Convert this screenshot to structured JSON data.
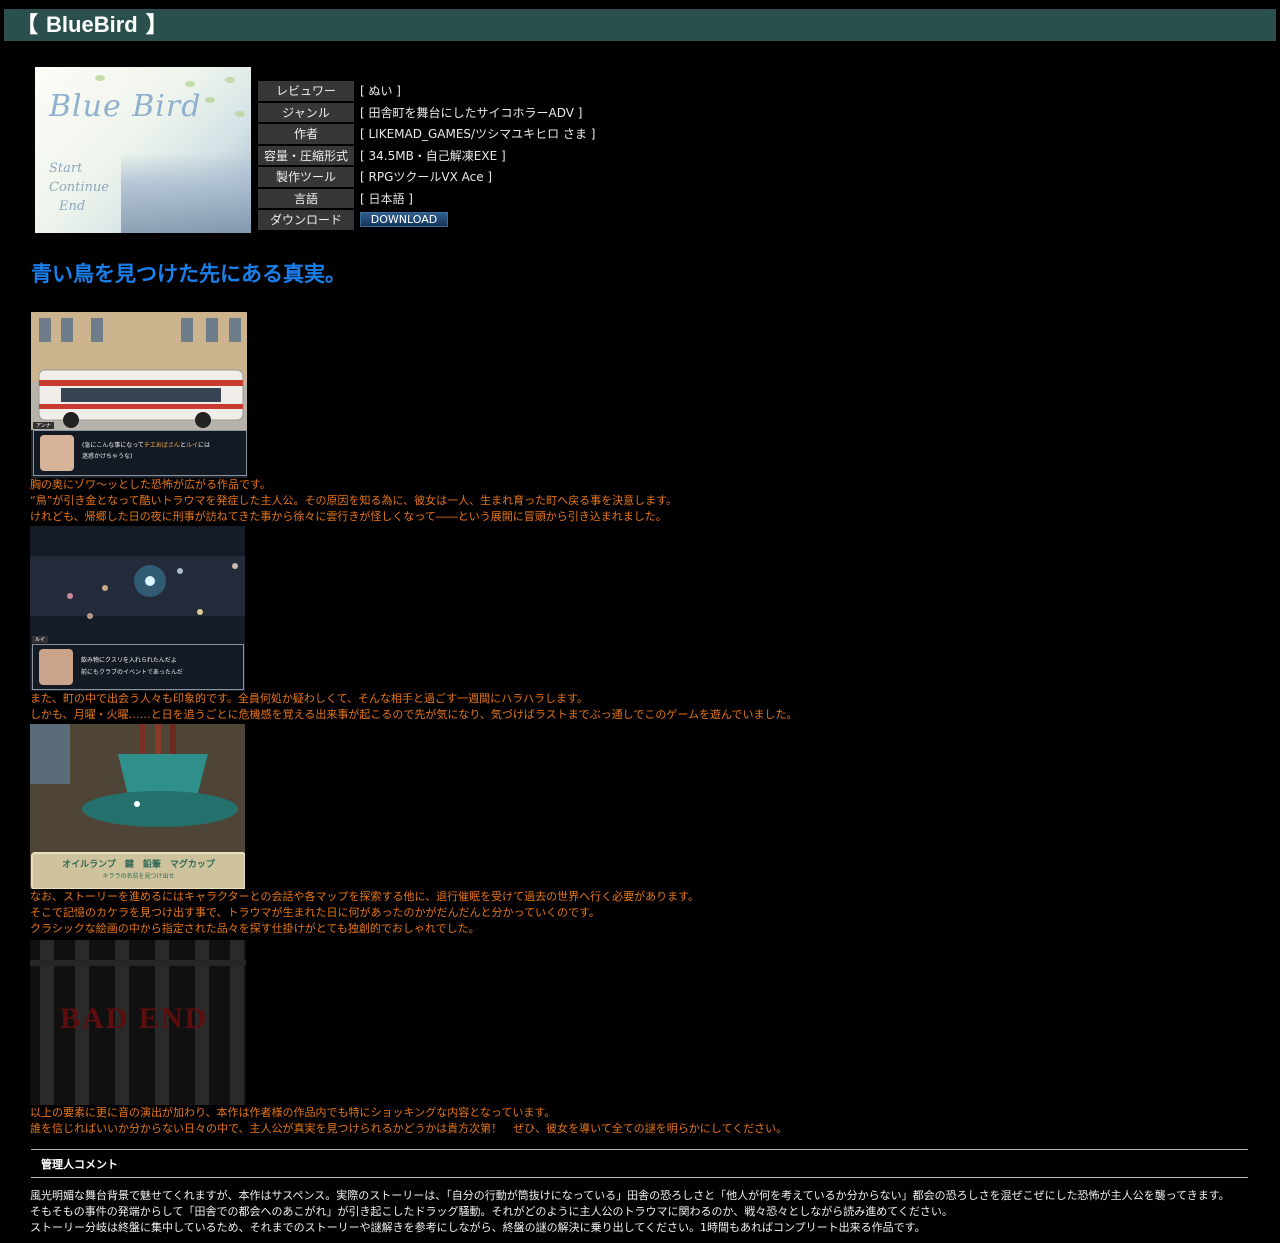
{
  "header": {
    "bracket_open": "【",
    "title": "BlueBird",
    "bracket_close": "】"
  },
  "cover": {
    "logo_text": "Blue Bird",
    "menu": [
      "Start",
      "Continue",
      "End"
    ]
  },
  "info": [
    {
      "label": "レビュワー",
      "value": "[ ぬい ]"
    },
    {
      "label": "ジャンル",
      "value": "[ 田舎町を舞台にしたサイコホラーADV ]"
    },
    {
      "label": "作者",
      "value": "[ LIKEMAD_GAMES/ツシマユキヒロ さま ]"
    },
    {
      "label": "容量・圧縮形式",
      "value": "[ 34.5MB・自己解凍EXE ]"
    },
    {
      "label": "製作ツール",
      "value": "[ RPGツクールVX Ace ]"
    },
    {
      "label": "言語",
      "value": "[ 日本語 ]"
    },
    {
      "label": "ダウンロード",
      "button": "DOWNLOAD"
    }
  ],
  "catchphrase": "青い鳥を見つけた先にある真実。",
  "screens": {
    "s1": {
      "name": "アンナ",
      "line1": "(急にこんな事になって",
      "highlight": "チエおばさん",
      "mid": "と",
      "highlight2": "ルイ",
      "tail": "には",
      "line2": "迷惑かけちゃうな)"
    },
    "s2": {
      "name": "ルイ",
      "line1": "飲み物にクスリを入れられたんだよ",
      "line2": "前にもクラブのイベントであったんだ"
    },
    "s3": {
      "banner": "オイルランプ　鍵　鉛筆　マグカップ",
      "sub": "キララの名前を見つけ出せ"
    },
    "s4": {
      "text": "BAD END"
    }
  },
  "paragraphs": {
    "p1": [
      "胸の奥にゾワ～ッとした恐怖が広がる作品です。",
      "“鳥”が引き金となって酷いトラウマを発症した主人公。その原因を知る為に、彼女は一人、生まれ育った町へ戻る事を決意します。",
      "けれども、帰郷した日の夜に刑事が訪ねてきた事から徐々に雲行きが怪しくなって――という展開に冒頭から引き込まれました。"
    ],
    "p2": [
      "また、町の中で出会う人々も印象的です。全員何処か疑わしくて、そんな相手と過ごす一週間にハラハラします。",
      "しかも、月曜・火曜……と日を追うごとに危機感を覚える出来事が起こるので先が気になり、気づけばラストまでぶっ通しでこのゲームを遊んでいました。"
    ],
    "p3": [
      "なお、ストーリーを進めるにはキャラクターとの会話や各マップを探索する他に、退行催眠を受けて過去の世界へ行く必要があります。",
      "そこで記憶のカケラを見つけ出す事で、トラウマが生まれた日に何があったのかがだんだんと分かっていくのです。",
      "クラシックな絵画の中から指定された品々を探す仕掛けがとても独創的でおしゃれでした。"
    ],
    "p4": [
      "以上の要素に更に音の演出が加わり、本作は作者様の作品内でも特にショッキングな内容となっています。",
      "誰を信じればいいか分からない日々の中で、主人公が真実を見つけられるかどうかは貴方次第！　ぜひ、彼女を導いて全ての謎を明らかにしてください。"
    ]
  },
  "admin": {
    "heading": "管理人コメント",
    "lines": [
      "風光明媚な舞台背景で魅せてくれますが、本作はサスペンス。実際のストーリーは、「自分の行動が筒抜けになっている」田舎の恐ろしさと「他人が何を考えているか分からない」都会の恐ろしさを混ぜこぜにした恐怖が主人公を襲ってきます。",
      "そもそもの事件の発端からして「田舎での都会へのあこがれ」が引き起こしたドラッグ騒動。それがどのように主人公のトラウマに関わるのか、戦々恐々としながら読み進めてください。",
      "ストーリー分岐は終盤に集中しているため、それまでのストーリーや謎解きを参考にしながら、終盤の謎の解決に乗り出してください。1時間もあればコンプリート出来る作品です。"
    ]
  }
}
